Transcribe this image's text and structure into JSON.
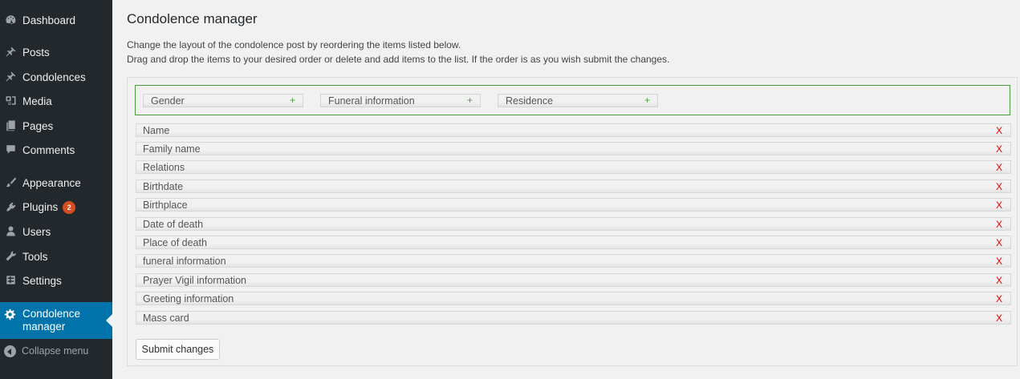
{
  "sidebar": {
    "items": [
      {
        "label": "Dashboard",
        "icon": "dashboard-icon"
      },
      {
        "label": "Posts",
        "icon": "pin-icon"
      },
      {
        "label": "Condolences",
        "icon": "pin-icon"
      },
      {
        "label": "Media",
        "icon": "media-icon"
      },
      {
        "label": "Pages",
        "icon": "pages-icon"
      },
      {
        "label": "Comments",
        "icon": "comment-icon"
      },
      {
        "label": "Appearance",
        "icon": "brush-icon"
      },
      {
        "label": "Plugins",
        "icon": "plugin-icon",
        "badge": "2"
      },
      {
        "label": "Users",
        "icon": "user-icon"
      },
      {
        "label": "Tools",
        "icon": "wrench-icon"
      },
      {
        "label": "Settings",
        "icon": "settings-icon"
      }
    ],
    "current": {
      "label": "Condolence manager",
      "icon": "gear-icon"
    },
    "collapse": "Collapse menu"
  },
  "page": {
    "title": "Condolence manager",
    "desc1": "Change the layout of the condolence post by reordering the items listed below.",
    "desc2": "Drag and drop the items to your desired order or delete and add items to the list. If the order is as you wish submit the changes."
  },
  "available": [
    {
      "label": "Gender",
      "add": "+"
    },
    {
      "label": "Funeral information",
      "add": "+"
    },
    {
      "label": "Residence",
      "add": "+"
    }
  ],
  "ordered": [
    {
      "label": "Name",
      "del": "X"
    },
    {
      "label": "Family name",
      "del": "X"
    },
    {
      "label": "Relations",
      "del": "X"
    },
    {
      "label": "Birthdate",
      "del": "X"
    },
    {
      "label": "Birthplace",
      "del": "X"
    },
    {
      "label": "Date of death",
      "del": "X"
    },
    {
      "label": "Place of death",
      "del": "X"
    },
    {
      "label": "funeral information",
      "del": "X"
    },
    {
      "label": "Prayer Vigil information",
      "del": "X"
    },
    {
      "label": "Greeting information",
      "del": "X"
    },
    {
      "label": "Mass card",
      "del": "X"
    }
  ],
  "submit": "Submit changes",
  "colors": {
    "sidebar": "#23282d",
    "accent": "#0073aa",
    "delete": "#dd0000",
    "add": "#4a9c3a",
    "badge": "#d54e21"
  }
}
